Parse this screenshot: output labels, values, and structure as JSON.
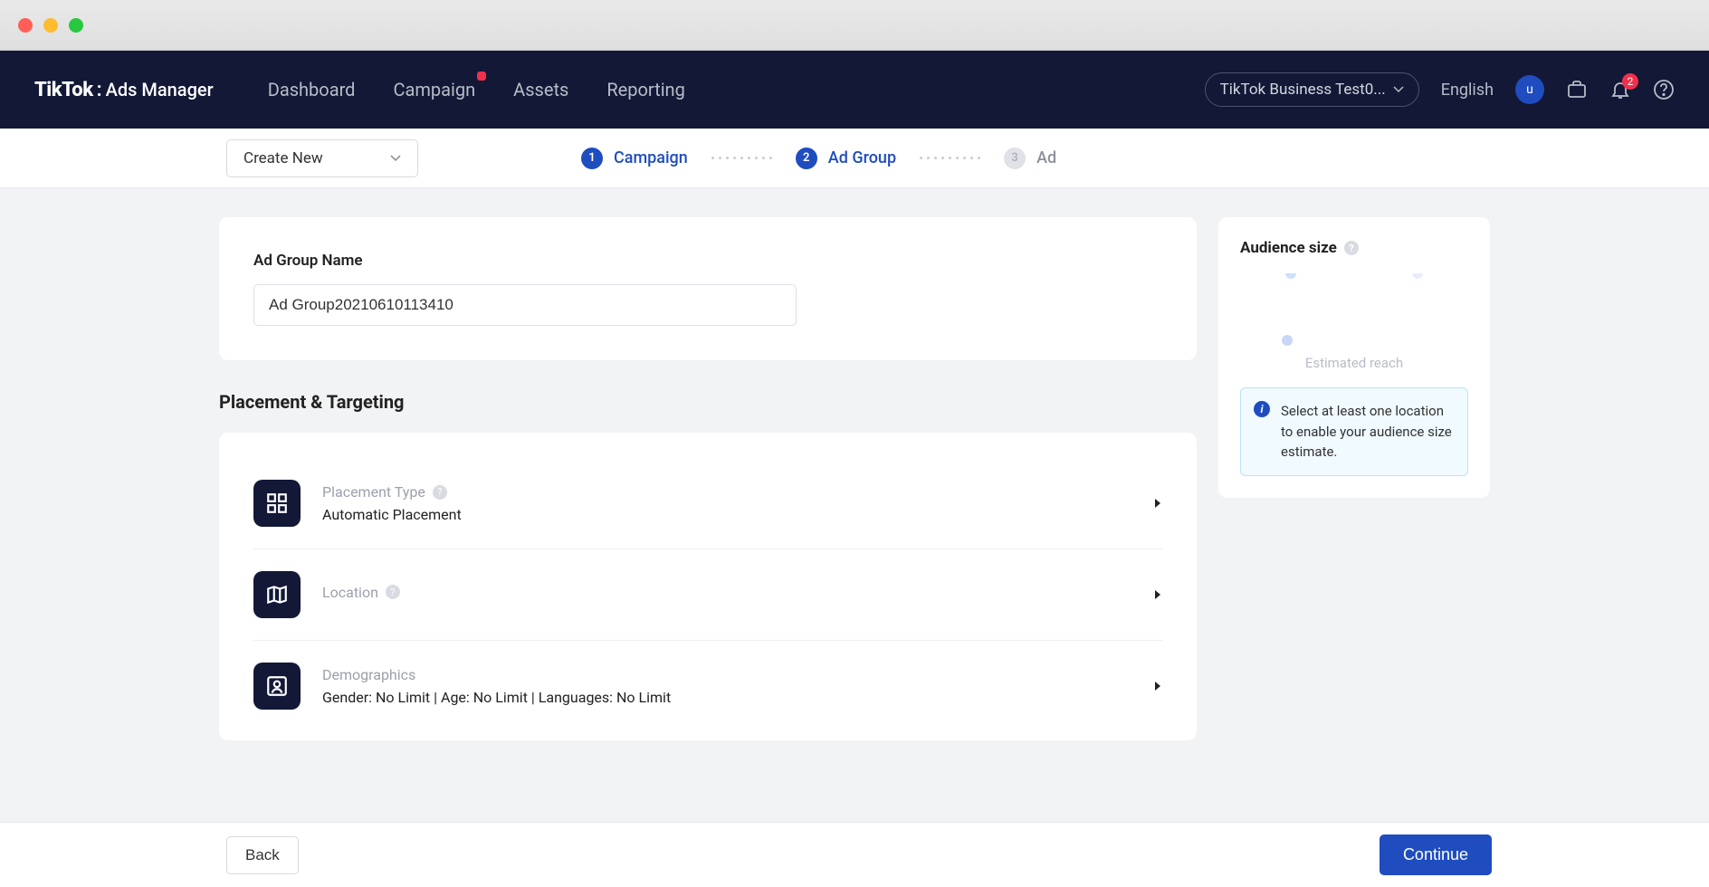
{
  "browser": {},
  "topnav": {
    "brand_a": "TikTok",
    "brand_sep": ":",
    "brand_b": "Ads Manager",
    "links": [
      "Dashboard",
      "Campaign",
      "Assets",
      "Reporting"
    ],
    "business_select": "TikTok Business Test0...",
    "language": "English",
    "avatar_letter": "u",
    "notif_count": "2"
  },
  "stepsbar": {
    "create_dd": "Create New",
    "steps": [
      {
        "num": "1",
        "label": "Campaign",
        "active": true
      },
      {
        "num": "2",
        "label": "Ad Group",
        "active": true
      },
      {
        "num": "3",
        "label": "Ad",
        "active": false
      }
    ]
  },
  "form": {
    "adgroup_label": "Ad Group Name",
    "adgroup_value": "Ad Group20210610113410",
    "section_title": "Placement & Targeting",
    "rows": [
      {
        "title": "Placement Type",
        "value": "Automatic Placement"
      },
      {
        "title": "Location",
        "value": ""
      },
      {
        "title": "Demographics",
        "value": "Gender: No Limit | Age: No Limit | Languages: No Limit"
      }
    ]
  },
  "side": {
    "title": "Audience size",
    "estimated": "Estimated reach",
    "alert": "Select at least one location to enable your audience size estimate."
  },
  "footer": {
    "back": "Back",
    "continue": "Continue"
  }
}
